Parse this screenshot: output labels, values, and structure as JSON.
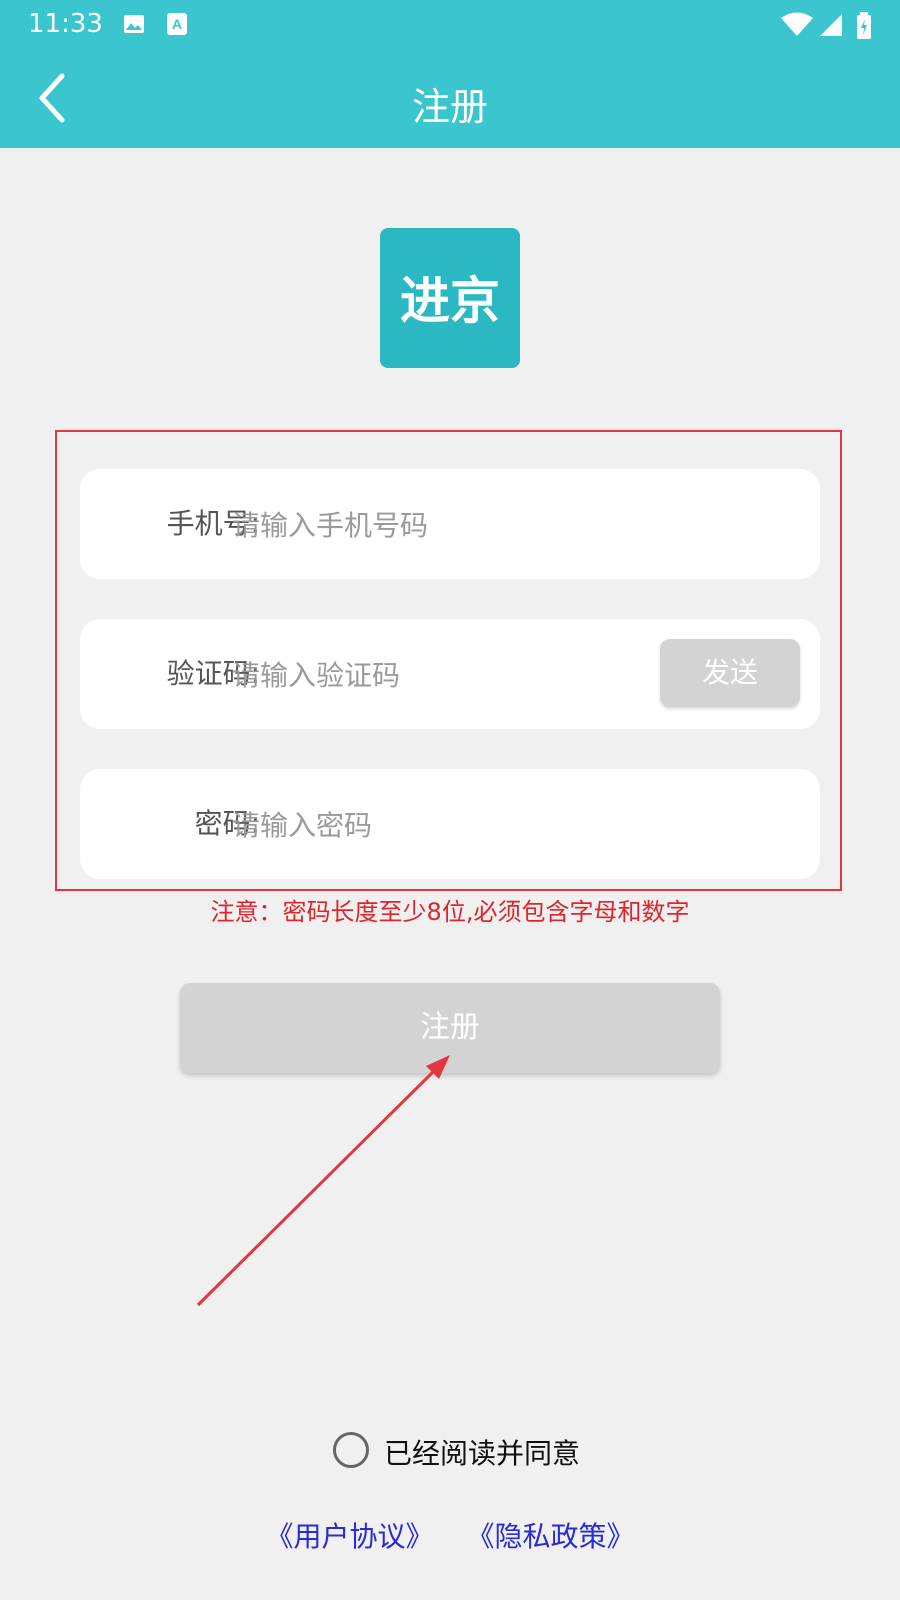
{
  "status_bar": {
    "time": "11:33",
    "icons": [
      "image-icon",
      "a-icon",
      "wifi-icon",
      "signal-icon",
      "battery-icon"
    ]
  },
  "app_bar": {
    "title": "注册",
    "back_icon": "chevron-left-icon"
  },
  "logo": {
    "text": "进京"
  },
  "form": {
    "phone": {
      "label": "手机号:",
      "placeholder": "请输入手机号码",
      "value": ""
    },
    "code": {
      "label": "验证码:",
      "placeholder": "请输入验证码",
      "value": "",
      "send_label": "发送"
    },
    "password": {
      "label": "密码:",
      "placeholder": "请输入密码",
      "value": ""
    }
  },
  "warning": "注意：密码长度至少8位,必须包含字母和数字",
  "register_label": "注册",
  "agreement": {
    "text": "已经阅读并同意",
    "user_agreement": "《用户协议》",
    "privacy_policy": "《隐私政策》"
  },
  "colors": {
    "accent": "#3bc6cf",
    "logo_bg": "#2bb8c3",
    "annotation_red": "#e0383e",
    "link_blue": "#2a2ad8",
    "disabled_gray": "#d3d3d3"
  }
}
